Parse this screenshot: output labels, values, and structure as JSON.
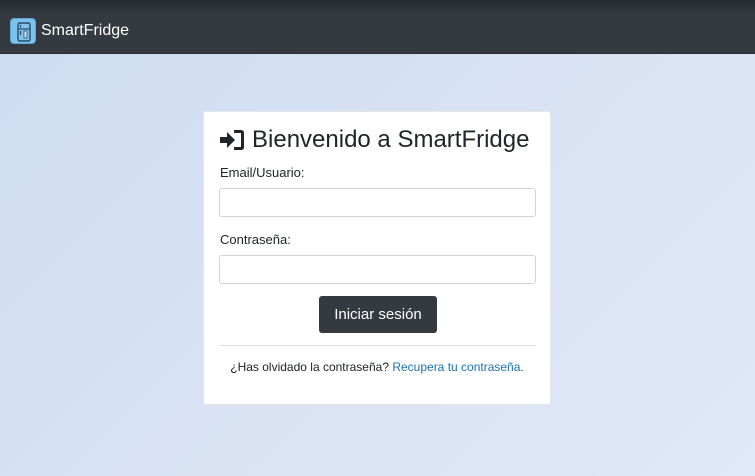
{
  "navbar": {
    "brand_name": "SmartFridge",
    "brand_icon": "fridge-icon",
    "background": "#343a40"
  },
  "login": {
    "title": "Bienvenido a SmartFridge",
    "title_icon": "sign-in-icon",
    "email_label": "Email/Usuario:",
    "email_value": "",
    "password_label": "Contraseña:",
    "password_value": "",
    "submit_label": "Iniciar sesión",
    "forgot_text": "¿Has olvidado la contraseña? ",
    "recover_link": "Recupera tu contraseña",
    "recover_suffix": ".",
    "link_color": "#1a73b8",
    "button_color": "#343a40"
  }
}
